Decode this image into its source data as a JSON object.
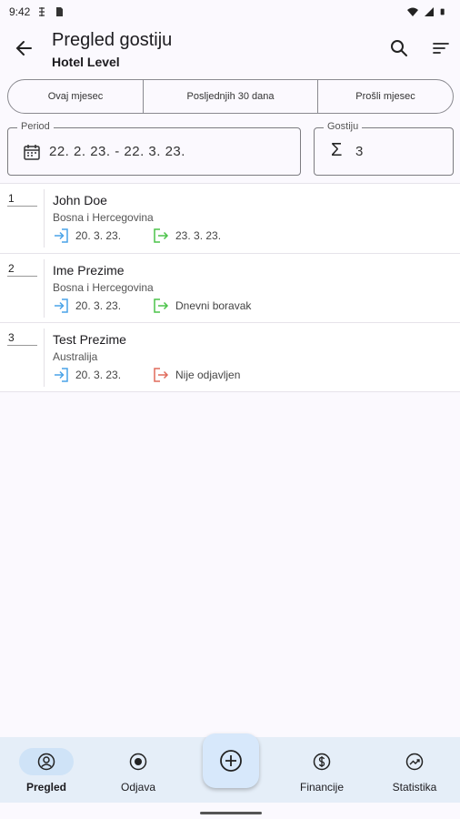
{
  "status_bar": {
    "time": "9:42"
  },
  "app_bar": {
    "title": "Pregled gostiju",
    "subtitle": "Hotel Level"
  },
  "segments": [
    "Ovaj mjesec",
    "Posljednjih 30 dana",
    "Prošli mjesec"
  ],
  "period": {
    "label": "Period",
    "value": "22. 2. 23. - 22. 3. 23."
  },
  "guests": {
    "label": "Gostiju",
    "value": "3"
  },
  "colors": {
    "checkin": "#4aa3e8",
    "checkout_done": "#4cc34a",
    "checkout_none": "#e06b5c"
  },
  "guest_list": [
    {
      "num": "1",
      "name": "John Doe",
      "country": "Bosna i Hercegovina",
      "checkin": "20. 3. 23.",
      "checkout": "23. 3. 23.",
      "checkout_state": "done"
    },
    {
      "num": "2",
      "name": "Ime Prezime",
      "country": "Bosna i Hercegovina",
      "checkin": "20. 3. 23.",
      "checkout": "Dnevni boravak",
      "checkout_state": "done"
    },
    {
      "num": "3",
      "name": "Test Prezime",
      "country": "Australija",
      "checkin": "20. 3. 23.",
      "checkout": "Nije odjavljen",
      "checkout_state": "none"
    }
  ],
  "bottom_nav": [
    {
      "label": "Pregled",
      "icon": "person-icon",
      "active": true
    },
    {
      "label": "Odjava",
      "icon": "record-icon",
      "active": false
    },
    {
      "label": "Financije",
      "icon": "dollar-icon",
      "active": false
    },
    {
      "label": "Statistika",
      "icon": "trend-icon",
      "active": false
    }
  ],
  "fab": {
    "icon": "add-circle-icon"
  }
}
